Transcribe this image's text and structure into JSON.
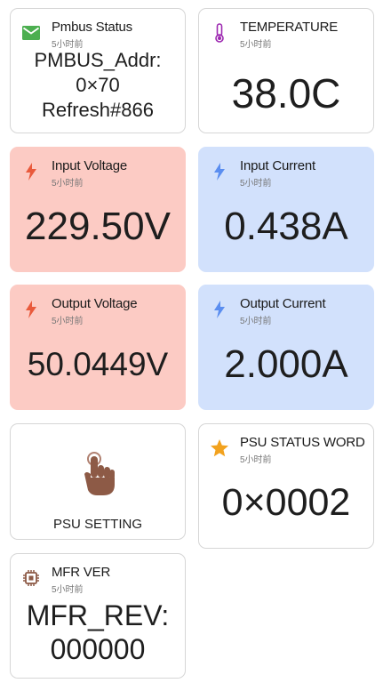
{
  "cards": {
    "pmbus_status": {
      "title": "Pmbus Status",
      "time": "5小时前",
      "lines": [
        "PMBUS_Addr:",
        "0×70",
        "Refresh#866"
      ],
      "icon": "mail-icon",
      "icon_color": "#4caf50"
    },
    "temperature": {
      "title": "TEMPERATURE",
      "time": "5小时前",
      "value": "38.0C",
      "icon": "thermometer-icon",
      "icon_color": "#9c27b0"
    },
    "input_voltage": {
      "title": "Input Voltage",
      "time": "5小时前",
      "value": "229.50V",
      "icon": "bolt-icon",
      "icon_color": "#e95a3c",
      "bg": "#fccbc4"
    },
    "input_current": {
      "title": "Input Current",
      "time": "5小时前",
      "value": "0.438A",
      "icon": "bolt-icon",
      "icon_color": "#5b8ef0",
      "bg": "#d2e1fc"
    },
    "output_voltage": {
      "title": "Output Voltage",
      "time": "5小时前",
      "value": "50.0449V",
      "icon": "bolt-icon",
      "icon_color": "#e95a3c",
      "bg": "#fccbc4"
    },
    "output_current": {
      "title": "Output Current",
      "time": "5小时前",
      "value": "2.000A",
      "icon": "bolt-icon",
      "icon_color": "#5b8ef0",
      "bg": "#d2e1fc"
    },
    "psu_setting": {
      "label": "PSU SETTING",
      "icon": "tap-hand-icon",
      "icon_color": "#8d5a46"
    },
    "psu_status_word": {
      "title": "PSU STATUS WORD",
      "time": "5小时前",
      "value": "0×0002",
      "icon": "star-icon",
      "icon_color": "#f2a21e"
    },
    "mfr_ver": {
      "title": "MFR VER",
      "time": "5小时前",
      "lines": [
        "MFR_REV:",
        "000000"
      ],
      "icon": "chip-icon",
      "icon_color": "#8d5a46"
    }
  }
}
